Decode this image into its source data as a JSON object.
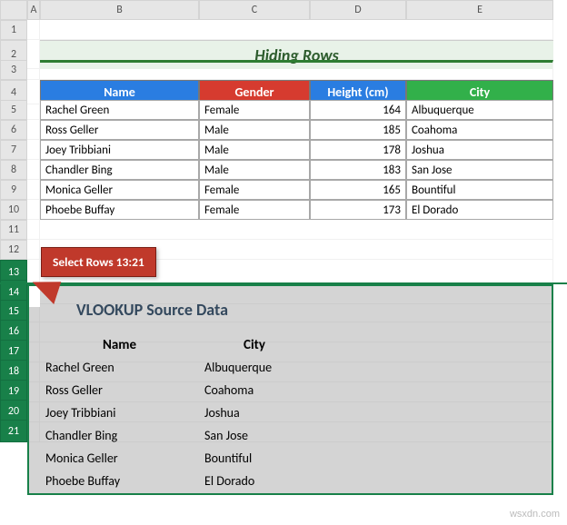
{
  "columns": [
    "",
    "A",
    "B",
    "C",
    "D",
    "E"
  ],
  "rows_visible": [
    "1",
    "2",
    "3",
    "4",
    "5",
    "6",
    "7",
    "8",
    "9",
    "10",
    "11",
    "12",
    "13",
    "14",
    "15",
    "16",
    "17",
    "18",
    "19",
    "20",
    "21"
  ],
  "title": "Hiding Rows",
  "table_headers": {
    "name": "Name",
    "gender": "Gender",
    "height": "Height (cm)",
    "city": "City"
  },
  "table_rows": [
    {
      "name": "Rachel Green",
      "gender": "Female",
      "height": "164",
      "city": "Albuquerque"
    },
    {
      "name": "Ross Geller",
      "gender": "Male",
      "height": "185",
      "city": "Coahoma"
    },
    {
      "name": "Joey Tribbiani",
      "gender": "Male",
      "height": "178",
      "city": "Joshua"
    },
    {
      "name": "Chandler Bing",
      "gender": "Male",
      "height": "183",
      "city": "San Jose"
    },
    {
      "name": "Monica Geller",
      "gender": "Female",
      "height": "165",
      "city": "Bountiful"
    },
    {
      "name": "Phoebe Buffay",
      "gender": "Female",
      "height": "173",
      "city": "El Dorado"
    }
  ],
  "callout_text": "Select Rows 13:21",
  "vlookup": {
    "title": "VLOOKUP Source Data",
    "headers": {
      "name": "Name",
      "city": "City"
    },
    "rows": [
      {
        "name": "Rachel Green",
        "city": "Albuquerque"
      },
      {
        "name": "Ross Geller",
        "city": "Coahoma"
      },
      {
        "name": "Joey Tribbiani",
        "city": "Joshua"
      },
      {
        "name": "Chandler Bing",
        "city": "San Jose"
      },
      {
        "name": "Monica Geller",
        "city": "Bountiful"
      },
      {
        "name": "Phoebe Buffay",
        "city": "El Dorado"
      }
    ]
  },
  "watermark": "wsxdn.com"
}
